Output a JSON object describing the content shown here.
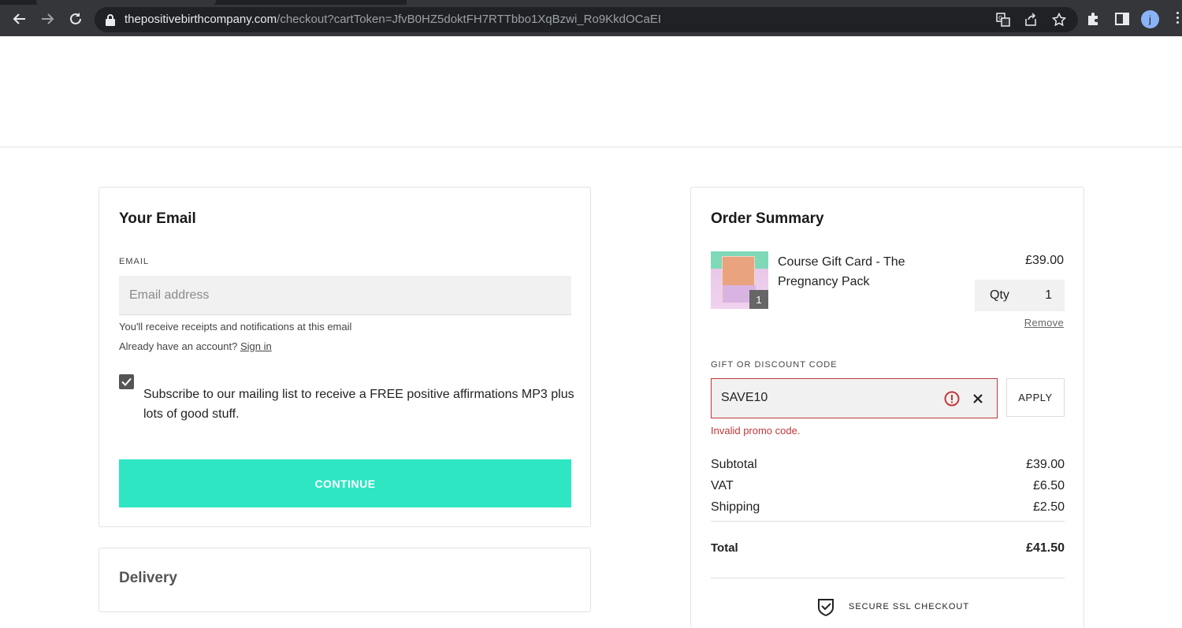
{
  "browser": {
    "url_host": "thepositivebirthcompany.com",
    "url_path": "/checkout?cartToken=JfvB0HZ5doktFH7RTTbbo1XqBzwi_Ro9KkdOCaEI",
    "avatar_initial": "j"
  },
  "email_section": {
    "title": "Your Email",
    "email_label": "EMAIL",
    "email_placeholder": "Email address",
    "email_value": "",
    "receipt_note": "You'll receive receipts and notifications at this email",
    "account_prompt": "Already have an account?",
    "sign_in_link": "Sign in",
    "subscribe_checked": true,
    "subscribe_text": "Subscribe to our mailing list to receive a FREE positive affirmations MP3 plus lots of good stuff.",
    "continue_label": "CONTINUE"
  },
  "delivery_section": {
    "title": "Delivery"
  },
  "order_summary": {
    "title": "Order Summary",
    "item": {
      "name": "Course Gift Card - The Pregnancy Pack",
      "price": "£39.00",
      "quantity_badge": "1",
      "qty_label": "Qty",
      "qty_value": "1",
      "remove_label": "Remove"
    },
    "discount": {
      "label": "GIFT OR DISCOUNT CODE",
      "code_value": "SAVE10",
      "apply_label": "APPLY",
      "error_message": "Invalid promo code."
    },
    "subtotal_label": "Subtotal",
    "subtotal_value": "£39.00",
    "vat_label": "VAT",
    "vat_value": "£6.50",
    "shipping_label": "Shipping",
    "shipping_value": "£2.50",
    "total_label": "Total",
    "total_value": "£41.50",
    "secure_label": "SECURE SSL CHECKOUT"
  },
  "colors": {
    "accent": "#2ee6c2",
    "error": "#c0383a"
  }
}
